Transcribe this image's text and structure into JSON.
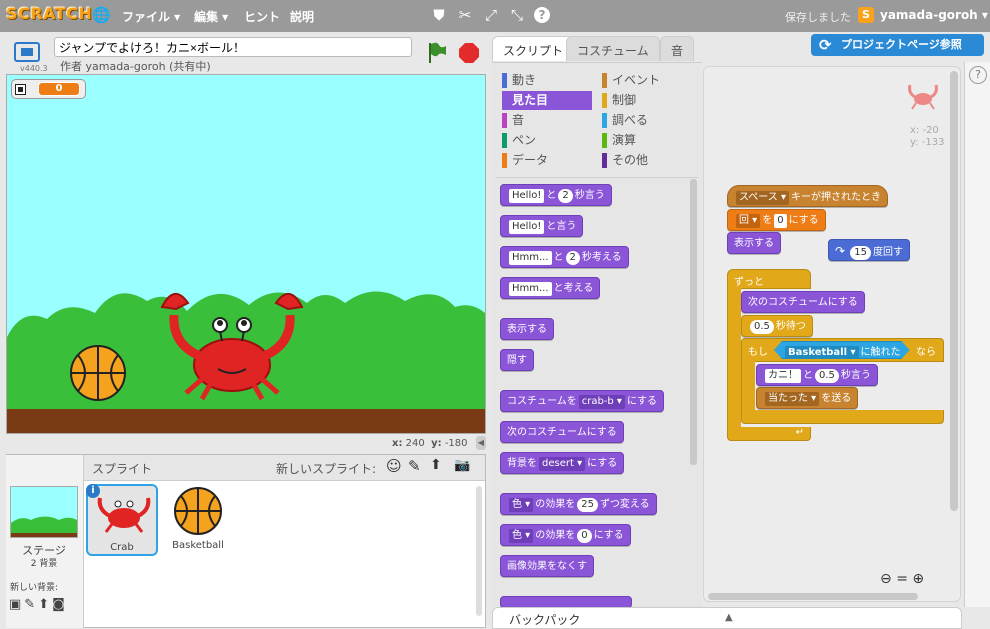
{
  "topbar": {
    "logo": "SCRATCH",
    "menus": [
      "ファイル ▾",
      "編集 ▾",
      "ヒント",
      "説明"
    ],
    "save_status": "保存しました",
    "username": "yamada-goroh ▾"
  },
  "stage_header": {
    "project_title": "ジャンプでよけろ！カニ×ボール！",
    "author": "作者 yamada-goroh (共有中)",
    "version": "v440.3"
  },
  "stage": {
    "variable_name": "",
    "variable_value": "0",
    "coords_x_label": "x:",
    "coords_x": "240",
    "coords_y_label": "y:",
    "coords_y": "-180"
  },
  "sprite_pane": {
    "header": "スプライト",
    "new_sprite_label": "新しいスプライト:",
    "stage_label": "ステージ",
    "stage_backdrops": "2 背景",
    "new_backdrop_label": "新しい背景:",
    "sprites": [
      {
        "name": "Crab",
        "selected": true
      },
      {
        "name": "Basketball",
        "selected": false
      }
    ]
  },
  "tabs": [
    "スクリプト",
    "コスチューム",
    "音"
  ],
  "project_page_button": "プロジェクトページ参照",
  "categories": {
    "left": [
      {
        "label": "動き",
        "color": "#4a6cd4"
      },
      {
        "label": "見た目",
        "color": "#8a55d7",
        "selected": true
      },
      {
        "label": "音",
        "color": "#bb42c3"
      },
      {
        "label": "ペン",
        "color": "#0e9a6c"
      },
      {
        "label": "データ",
        "color": "#ee7d16"
      }
    ],
    "right": [
      {
        "label": "イベント",
        "color": "#c88330"
      },
      {
        "label": "制御",
        "color": "#e1a91a"
      },
      {
        "label": "調べる",
        "color": "#2ca5e2"
      },
      {
        "label": "演算",
        "color": "#5cb712"
      },
      {
        "label": "その他",
        "color": "#632d99"
      }
    ]
  },
  "palette_blocks": {
    "say_for": {
      "pre": "Hello!",
      "mid": "と",
      "num": "2",
      "post": "秒言う"
    },
    "say": {
      "pre": "Hello!",
      "post": "と言う"
    },
    "think_for": {
      "pre": "Hmm...",
      "mid": "と",
      "num": "2",
      "post": "秒考える"
    },
    "think": {
      "pre": "Hmm...",
      "post": "と考える"
    },
    "show": "表示する",
    "hide": "隠す",
    "switch_costume": {
      "pre": "コスチュームを",
      "val": "crab-b ▾",
      "post": "にする"
    },
    "next_costume": "次のコスチュームにする",
    "switch_backdrop": {
      "pre": "背景を",
      "val": "desert ▾",
      "post": "にする"
    },
    "change_effect": {
      "val": "色 ▾",
      "mid": "の効果を",
      "num": "25",
      "post": "ずつ変える"
    },
    "set_effect": {
      "val": "色 ▾",
      "mid": "の効果を",
      "num": "0",
      "post": "にする"
    },
    "clear_effects": "画像効果をなくす"
  },
  "script": {
    "sprite_x": "x: -20",
    "sprite_y": "y: -133",
    "hat": {
      "key": "スペース ▾",
      "post": "キーが押されたとき"
    },
    "set_var": {
      "var": "回 ▾",
      "mid": "を",
      "num": "0",
      "post": "にする"
    },
    "show": "表示する",
    "turn": {
      "num": "15",
      "post": "度回す"
    },
    "forever": "ずっと",
    "next_costume": "次のコスチュームにする",
    "wait": {
      "num": "0.5",
      "post": "秒待つ"
    },
    "if_label": "もし",
    "touching": {
      "val": "Basketball ▾",
      "post": "に触れた"
    },
    "then_label": "なら",
    "say_for": {
      "text": "カニ！",
      "mid": "と",
      "num": "0.5",
      "post": "秒言う"
    },
    "broadcast": {
      "val": "当たった ▾",
      "post": "を送る"
    }
  },
  "backpack": "バックパック"
}
